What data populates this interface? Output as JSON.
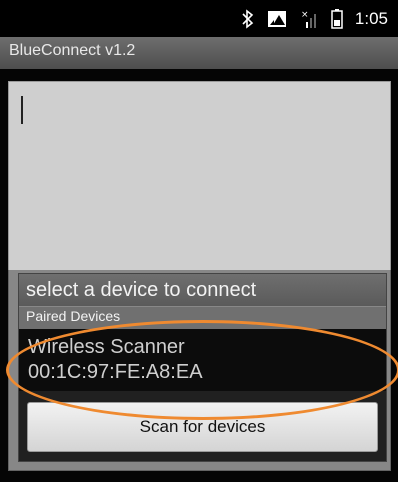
{
  "status_bar": {
    "time": "1:05",
    "icons": [
      "bluetooth-icon",
      "data-icon",
      "signal-icon",
      "battery-icon"
    ]
  },
  "app": {
    "title": "BlueConnect v1.2"
  },
  "dialog": {
    "title": "select a device to connect",
    "section_header": "Paired Devices",
    "devices": [
      {
        "name": "Wireless Scanner",
        "address": "00:1C:97:FE:A8:EA"
      }
    ],
    "scan_button_label": "Scan for devices"
  },
  "colors": {
    "highlight": "#ef8a30"
  }
}
